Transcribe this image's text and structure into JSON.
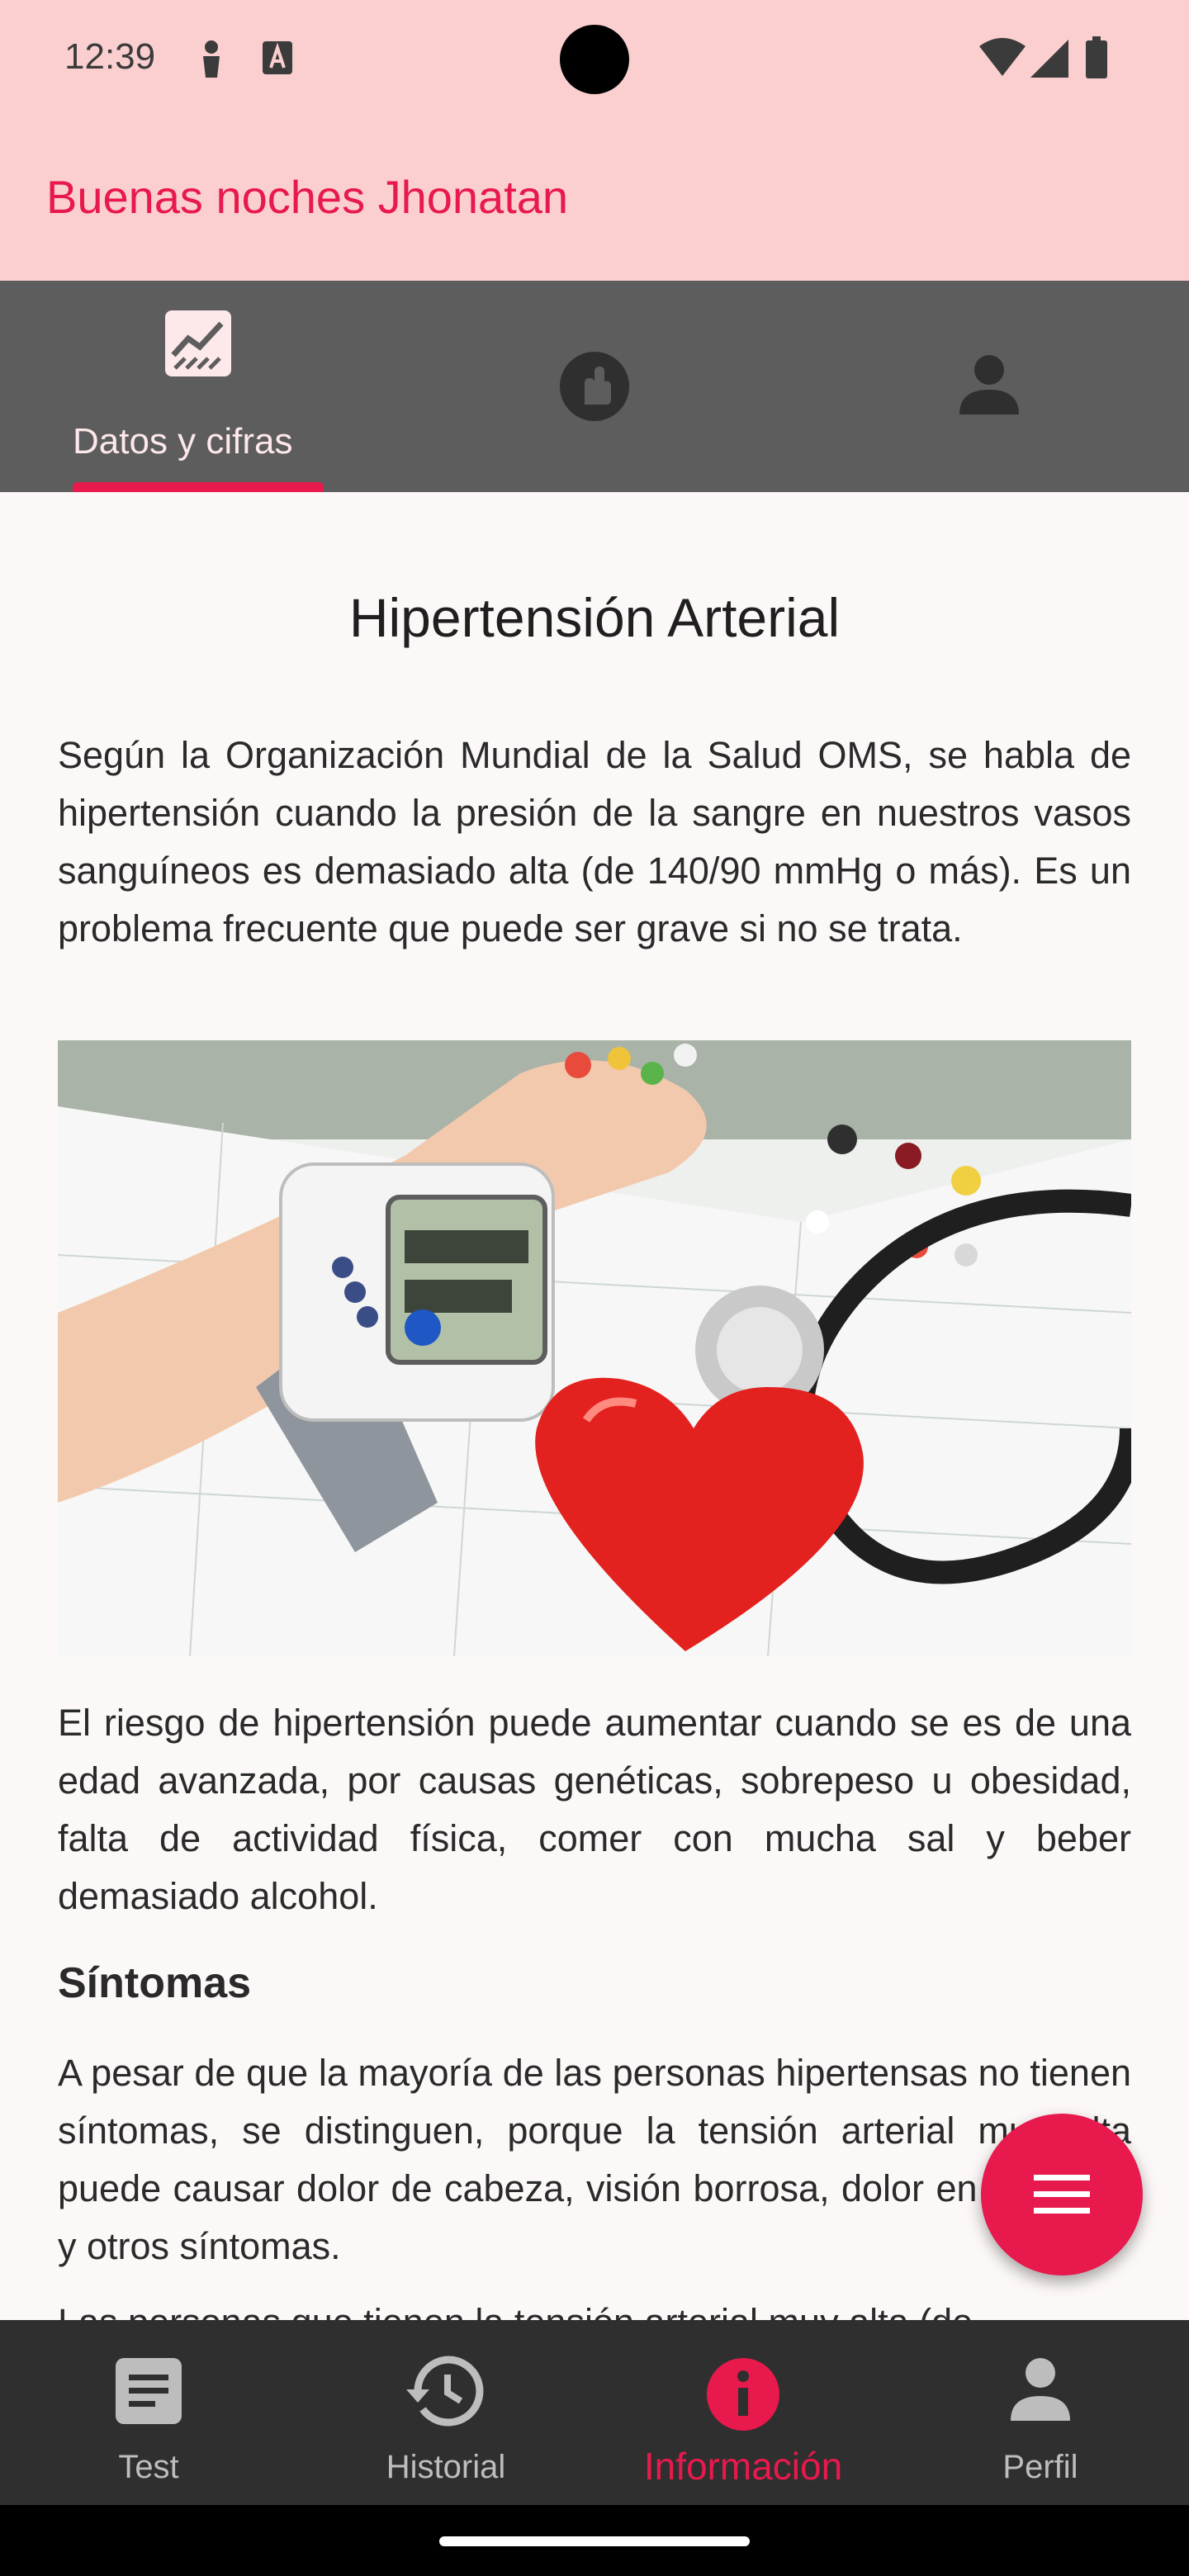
{
  "status_bar": {
    "time": "12:39"
  },
  "header": {
    "greeting": "Buenas noches Jhonatan"
  },
  "top_tabs": {
    "active_label": "Datos y cifras",
    "tabs": [
      {
        "icon": "chart-icon"
      },
      {
        "icon": "hand-icon"
      },
      {
        "icon": "person-icon"
      }
    ]
  },
  "article": {
    "title": "Hipertensión Arterial",
    "paragraph1": "Según la Organización Mundial de la Salud OMS, se habla de hipertensión cuando la presión de la sangre en nuestros vasos sanguíneos es demasiado alta (de 140/90 mmHg o más). Es un problema frecuente que puede ser grave si no se trata.",
    "paragraph2": "El riesgo de hipertensión puede aumentar cuando se es de una edad avanzada, por causas genéticas, sobrepeso u obesidad, falta de actividad física, comer con mucha sal y beber demasiado alcohol.",
    "symptoms_heading": "Síntomas",
    "paragraph3": "A pesar de que la mayoría de las personas hipertensas no tienen síntomas, se distinguen, porque la tensión arterial muy alta puede causar dolor de cabeza, visión borrosa, dolor en el pecho y otros síntomas.",
    "paragraph4": "Las personas que tienen la tensión arterial muy alta (de"
  },
  "bottom_nav": {
    "items": [
      {
        "label": "Test",
        "icon": "document-icon"
      },
      {
        "label": "Historial",
        "icon": "history-icon"
      },
      {
        "label": "Información",
        "icon": "info-icon"
      },
      {
        "label": "Perfil",
        "icon": "person-icon"
      }
    ],
    "active_index": 2
  },
  "colors": {
    "accent": "#e8194c",
    "header_bg": "#fbcfd0",
    "tabs_bg": "#5d5d5d",
    "nav_bg": "#2f2f2f"
  }
}
